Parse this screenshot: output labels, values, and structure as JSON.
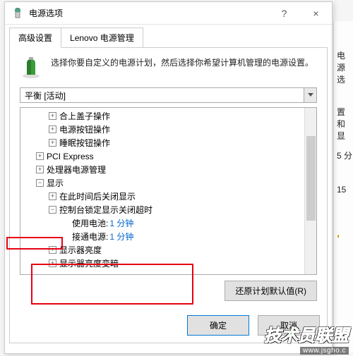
{
  "window": {
    "title": "电源选项",
    "help_label": "?",
    "close_label": "×"
  },
  "tabs": [
    {
      "label": "高级设置",
      "active": true
    },
    {
      "label": "Lenovo 电源管理",
      "active": false
    }
  ],
  "description": "选择你要自定义的电源计划，然后选择你希望计算机管理的电源设置。",
  "plan_selector": {
    "value": "平衡 [活动]"
  },
  "tree": [
    {
      "indent": 2,
      "expander": "plus",
      "label": "合上盖子操作"
    },
    {
      "indent": 2,
      "expander": "plus",
      "label": "电源按钮操作"
    },
    {
      "indent": 2,
      "expander": "plus",
      "label": "睡眠按钮操作"
    },
    {
      "indent": 1,
      "expander": "plus",
      "label": "PCI Express"
    },
    {
      "indent": 1,
      "expander": "plus",
      "label": "处理器电源管理"
    },
    {
      "indent": 1,
      "expander": "minus",
      "label": "显示",
      "hl": "a"
    },
    {
      "indent": 2,
      "expander": "plus",
      "label": "在此时间后关闭显示"
    },
    {
      "indent": 2,
      "expander": "minus",
      "label": "控制台锁定显示关闭超时",
      "hl": "b"
    },
    {
      "indent": 3,
      "expander": "none",
      "label": "使用电池:",
      "value": "1 分钟",
      "hl": "b"
    },
    {
      "indent": 3,
      "expander": "none",
      "label": "接通电源:",
      "value": "1 分钟",
      "hl": "b"
    },
    {
      "indent": 2,
      "expander": "plus",
      "label": "显示器亮度"
    },
    {
      "indent": 2,
      "expander": "plus",
      "label": "显示器亮度变暗"
    }
  ],
  "buttons": {
    "restore_defaults": "还原计划默认值(R)",
    "ok": "确定",
    "cancel": "取消"
  },
  "right_pane": {
    "title": "电源选",
    "row1": "置和显",
    "val1": "5 分",
    "val2": "15"
  },
  "watermark": {
    "main": "技术员联盟",
    "sub": "www.jsgho.c"
  }
}
